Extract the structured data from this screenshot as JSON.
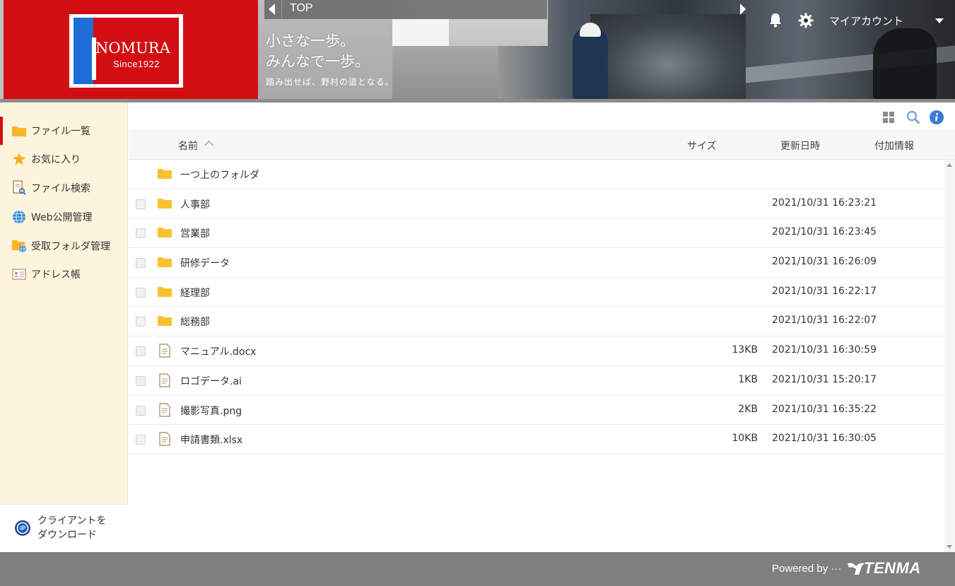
{
  "header": {
    "logo_text": "NOMURA",
    "logo_since": "Since1922",
    "tagline_line1": "小さな一歩。",
    "tagline_line2": "みんなで一歩。",
    "tagline_sub": "踏み出せば、野村の道となる。",
    "top_label": "TOP",
    "account_label": "マイアカウント"
  },
  "sidebar": {
    "items": [
      {
        "label": "ファイル一覧",
        "icon": "folder-icon",
        "active": true
      },
      {
        "label": "お気に入り",
        "icon": "star-icon"
      },
      {
        "label": "ファイル検索",
        "icon": "file-search-icon"
      },
      {
        "label": "Web公開管理",
        "icon": "globe-icon"
      },
      {
        "label": "受取フォルダ管理",
        "icon": "receive-folder-icon"
      },
      {
        "label": "アドレス帳",
        "icon": "address-book-icon"
      }
    ],
    "download_line1": "クライアントを",
    "download_line2": "ダウンロード"
  },
  "table": {
    "columns": {
      "name": "名前",
      "size": "サイズ",
      "date": "更新日時",
      "extra": "付加情報"
    },
    "parent_folder": "一つ上のフォルダ",
    "rows": [
      {
        "name": "人事部",
        "type": "folder",
        "size": "",
        "date": "2021/10/31 16:23:21"
      },
      {
        "name": "営業部",
        "type": "folder",
        "size": "",
        "date": "2021/10/31 16:23:45"
      },
      {
        "name": "研修データ",
        "type": "folder",
        "size": "",
        "date": "2021/10/31 16:26:09"
      },
      {
        "name": "経理部",
        "type": "folder",
        "size": "",
        "date": "2021/10/31 16:22:17"
      },
      {
        "name": "総務部",
        "type": "folder",
        "size": "",
        "date": "2021/10/31 16:22:07"
      },
      {
        "name": "マニュアル.docx",
        "type": "file",
        "size": "13KB",
        "date": "2021/10/31 16:30:59"
      },
      {
        "name": "ロゴデータ.ai",
        "type": "file",
        "size": "1KB",
        "date": "2021/10/31 15:20:17"
      },
      {
        "name": "撮影写真.png",
        "type": "file",
        "size": "2KB",
        "date": "2021/10/31 16:35:22"
      },
      {
        "name": "申請書類.xlsx",
        "type": "file",
        "size": "10KB",
        "date": "2021/10/31 16:30:05"
      }
    ]
  },
  "footer": {
    "powered_by": "Powered by ···",
    "brand": "TENMA"
  },
  "colors": {
    "brand_red": "#d30e13",
    "brand_blue": "#1c6fd6",
    "folder_yellow": "#f8c22f",
    "sidebar_bg": "#fdf4dc",
    "footer_bg": "#7f7f7f",
    "info_blue": "#3d7ad6"
  }
}
